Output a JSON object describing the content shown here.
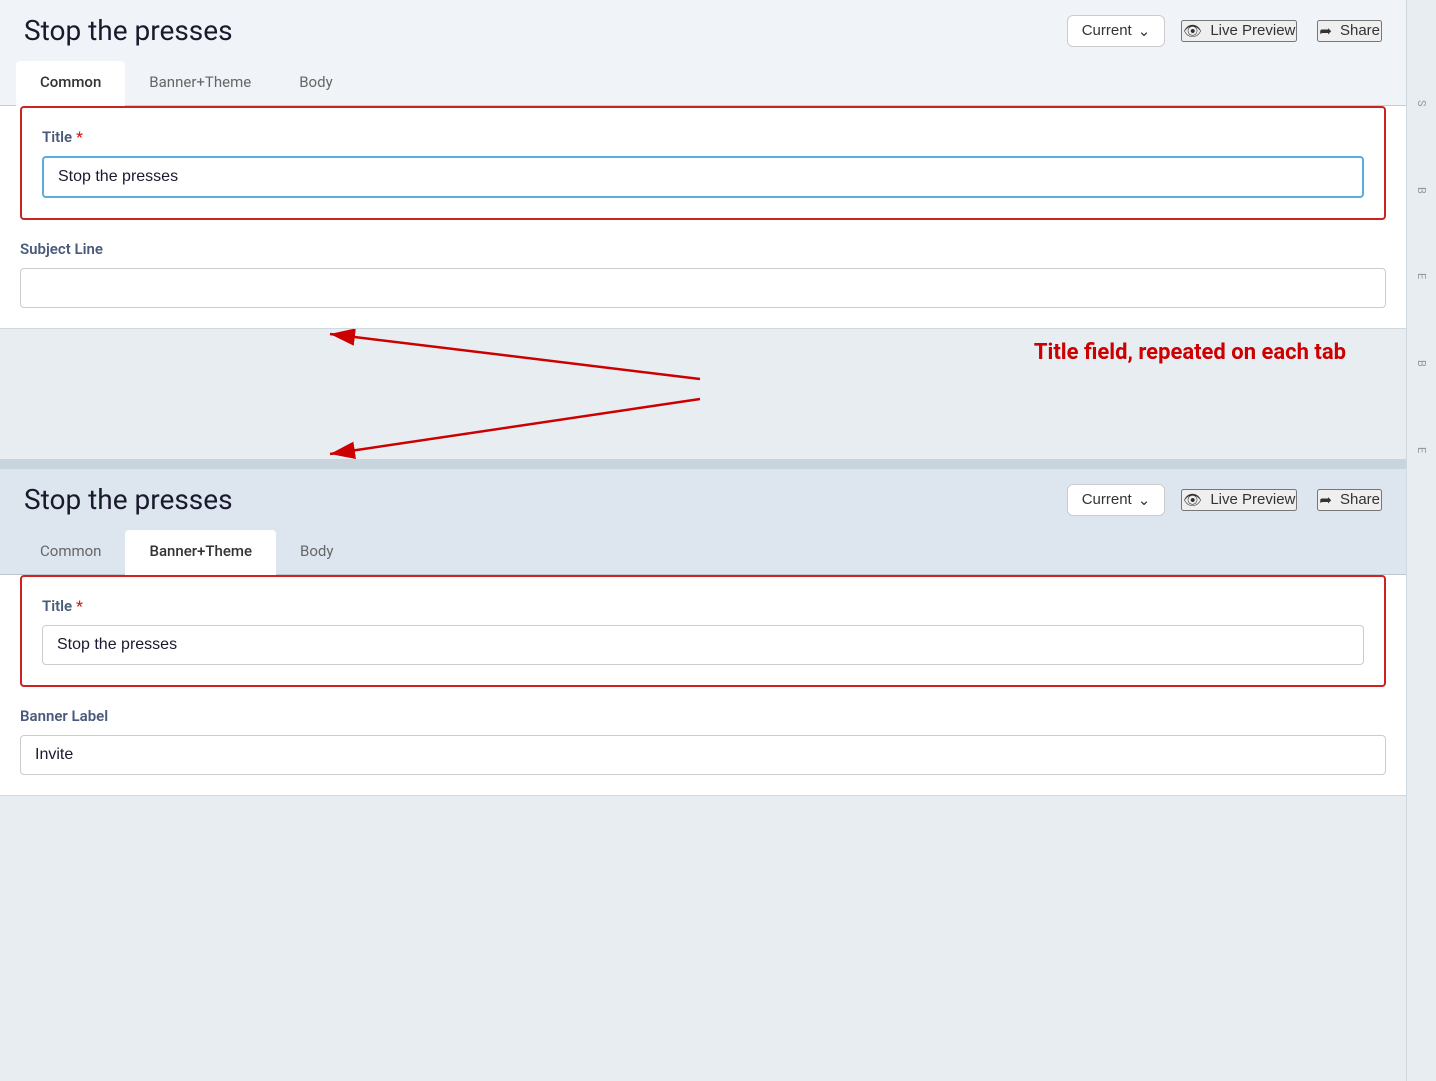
{
  "top_panel": {
    "title": "Stop the presses",
    "version_label": "Current",
    "live_preview_label": "Live Preview",
    "share_label": "Share",
    "tabs": [
      {
        "id": "common",
        "label": "Common",
        "active": true
      },
      {
        "id": "banner_theme",
        "label": "Banner+Theme",
        "active": false
      },
      {
        "id": "body",
        "label": "Body",
        "active": false
      }
    ],
    "title_field": {
      "label": "Title",
      "required": true,
      "value": "Stop the presses",
      "placeholder": ""
    },
    "subject_line_field": {
      "label": "Subject Line",
      "value": "",
      "placeholder": ""
    }
  },
  "annotation": {
    "text": "Title field, repeated on each tab"
  },
  "bottom_panel": {
    "title": "Stop the presses",
    "version_label": "Current",
    "live_preview_label": "Live Preview",
    "share_label": "Share",
    "tabs": [
      {
        "id": "common",
        "label": "Common",
        "active": false
      },
      {
        "id": "banner_theme",
        "label": "Banner+Theme",
        "active": true
      },
      {
        "id": "body",
        "label": "Body",
        "active": false
      }
    ],
    "title_field": {
      "label": "Title",
      "required": true,
      "value": "Stop the presses",
      "placeholder": ""
    },
    "banner_label_field": {
      "label": "Banner Label",
      "value": "Invite",
      "placeholder": ""
    }
  },
  "icons": {
    "eye": "👁",
    "share": "↪",
    "chevron_down": "∨"
  }
}
